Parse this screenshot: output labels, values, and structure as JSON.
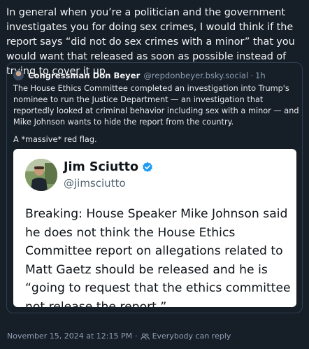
{
  "post": {
    "text": "In general when you’re a politician and the government investigates you for doing sex crimes, I would think if the report says “did not do sex crimes with a minor” that you would want that released as soon as possible instead of trying to cover it up"
  },
  "quote": {
    "author_name": "Congressman Don Beyer",
    "author_handle": "@repdonbeyer.bsky.social",
    "separator": "·",
    "time": "1h",
    "text": "The House Ethics Committee completed an investigation into Trump's nominee to run the Justice Department — an investigation that reportedly looked at criminal behavior including sex with a minor — and Mike Johnson wants to hide the report from the country.",
    "text2": "A *massive* red flag.",
    "embed": {
      "name": "Jim Sciutto",
      "handle": "@jimsciutto",
      "text": "Breaking: House Speaker Mike Johnson said he does not think the House Ethics Committee report on allegations related to Matt Gaetz should be released and he is “going to request that the ethics committee not release the report.”",
      "verified_icon": "verified-badge-icon",
      "verified_color": "#1d9bf0"
    }
  },
  "footer": {
    "timestamp": "November 15, 2024 at 12:15 PM",
    "separator": "·",
    "reply_setting": "Everybody can reply",
    "reply_icon": "people-icon"
  },
  "colors": {
    "background": "#161e27",
    "border": "#2e4052",
    "muted": "#8d9fb4"
  }
}
